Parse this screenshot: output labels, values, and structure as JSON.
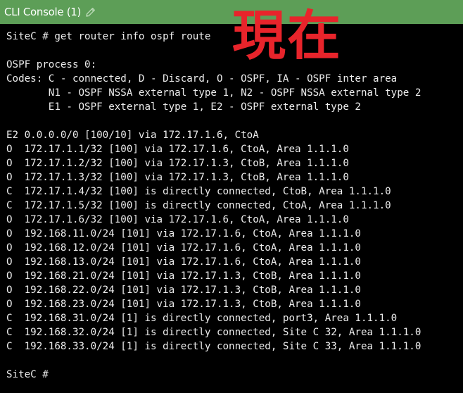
{
  "window": {
    "title": "CLI Console (1)",
    "edit_icon": "pencil-icon",
    "titlebar_color": "#5d9e57",
    "background_color": "#000000",
    "text_color": "#ececec"
  },
  "annotation": {
    "text": "現在",
    "color": "#e8242b"
  },
  "console": {
    "lines": [
      "SiteC # get router info ospf route",
      "",
      "OSPF process 0:",
      "Codes: C - connected, D - Discard, O - OSPF, IA - OSPF inter area",
      "       N1 - OSPF NSSA external type 1, N2 - OSPF NSSA external type 2",
      "       E1 - OSPF external type 1, E2 - OSPF external type 2",
      "",
      "E2 0.0.0.0/0 [100/10] via 172.17.1.6, CtoA",
      "O  172.17.1.1/32 [100] via 172.17.1.6, CtoA, Area 1.1.1.0",
      "O  172.17.1.2/32 [100] via 172.17.1.3, CtoB, Area 1.1.1.0",
      "O  172.17.1.3/32 [100] via 172.17.1.3, CtoB, Area 1.1.1.0",
      "C  172.17.1.4/32 [100] is directly connected, CtoB, Area 1.1.1.0",
      "C  172.17.1.5/32 [100] is directly connected, CtoA, Area 1.1.1.0",
      "O  172.17.1.6/32 [100] via 172.17.1.6, CtoA, Area 1.1.1.0",
      "O  192.168.11.0/24 [101] via 172.17.1.6, CtoA, Area 1.1.1.0",
      "O  192.168.12.0/24 [101] via 172.17.1.6, CtoA, Area 1.1.1.0",
      "O  192.168.13.0/24 [101] via 172.17.1.6, CtoA, Area 1.1.1.0",
      "O  192.168.21.0/24 [101] via 172.17.1.3, CtoB, Area 1.1.1.0",
      "O  192.168.22.0/24 [101] via 172.17.1.3, CtoB, Area 1.1.1.0",
      "O  192.168.23.0/24 [101] via 172.17.1.3, CtoB, Area 1.1.1.0",
      "C  192.168.31.0/24 [1] is directly connected, port3, Area 1.1.1.0",
      "C  192.168.32.0/24 [1] is directly connected, Site C 32, Area 1.1.1.0",
      "C  192.168.33.0/24 [1] is directly connected, Site C 33, Area 1.1.1.0",
      "",
      "SiteC #"
    ]
  }
}
